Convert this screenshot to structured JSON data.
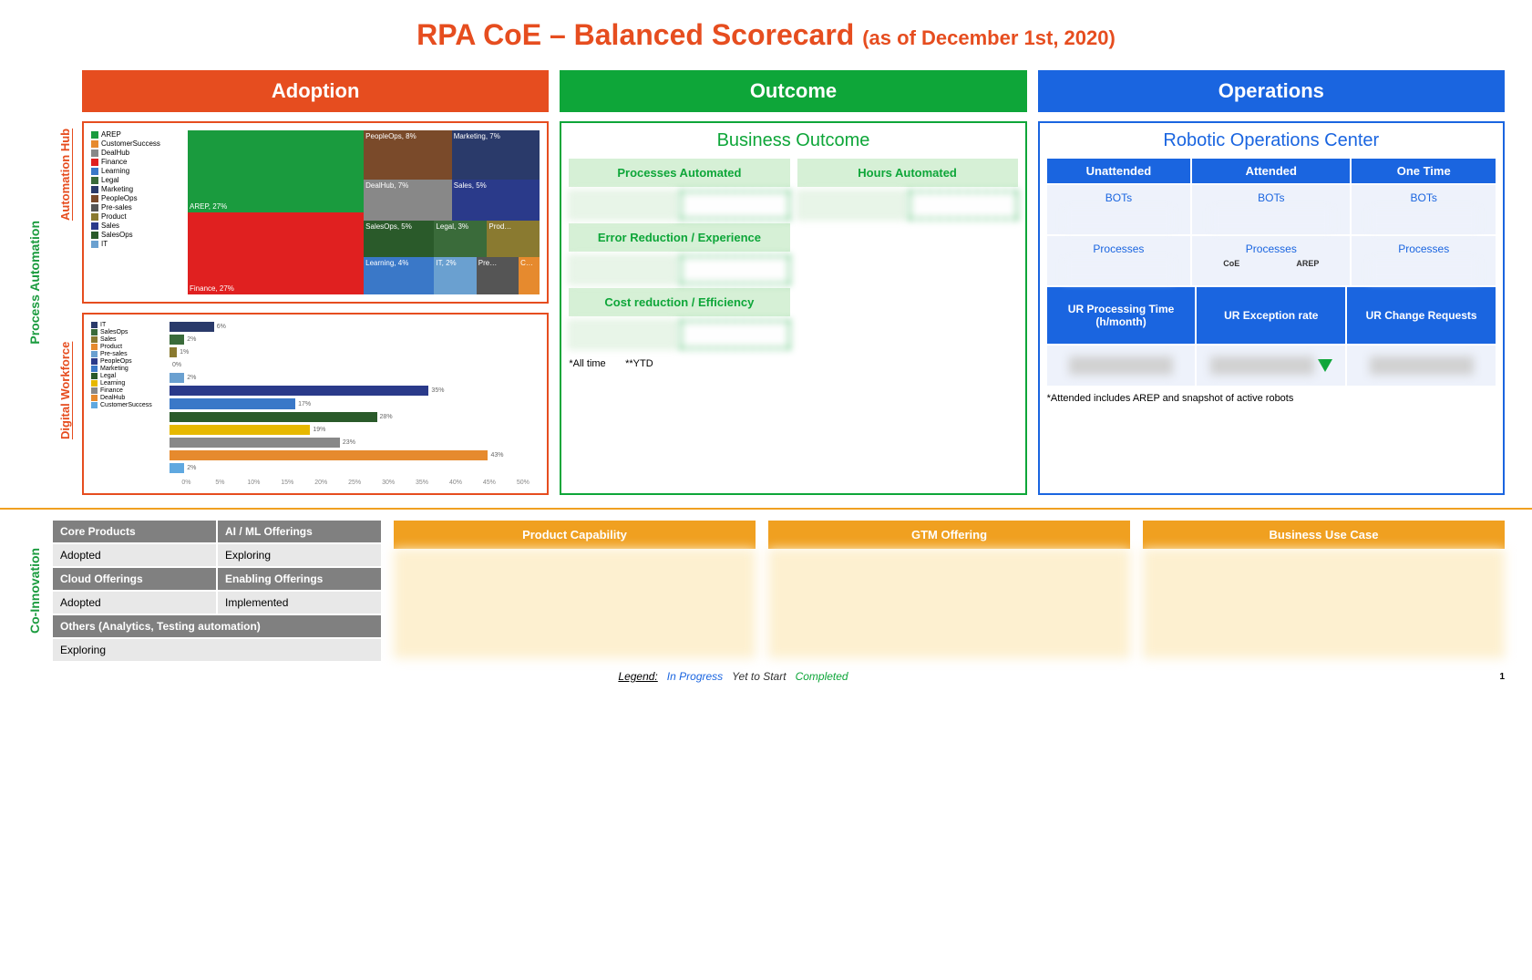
{
  "title": {
    "main": "RPA CoE – Balanced Scorecard ",
    "sub": "(as of December 1st, 2020)"
  },
  "section_label": "Process Automation",
  "panel_labels": {
    "hub": "Automation Hub",
    "dw": "Digital Workforce"
  },
  "columns": {
    "adoption": "Adoption",
    "outcome": "Outcome",
    "operations": "Operations"
  },
  "treemap_legend": [
    {
      "name": "AREP",
      "color": "#1a9b3e"
    },
    {
      "name": "CustomerSuccess",
      "color": "#e68a2e"
    },
    {
      "name": "DealHub",
      "color": "#888888"
    },
    {
      "name": "Finance",
      "color": "#e02020"
    },
    {
      "name": "Learning",
      "color": "#3a78c8"
    },
    {
      "name": "Legal",
      "color": "#3a6b3a"
    },
    {
      "name": "Marketing",
      "color": "#2a3a6a"
    },
    {
      "name": "PeopleOps",
      "color": "#7a4a2a"
    },
    {
      "name": "Pre-sales",
      "color": "#555555"
    },
    {
      "name": "Product",
      "color": "#8a7a30"
    },
    {
      "name": "Sales",
      "color": "#2a3a8a"
    },
    {
      "name": "SalesOps",
      "color": "#2a5a2a"
    },
    {
      "name": "IT",
      "color": "#6aa0d0"
    }
  ],
  "chart_data": [
    {
      "type": "treemap",
      "title": "Automation Hub",
      "unit": "percent",
      "data": [
        {
          "name": "AREP",
          "value": 27,
          "color": "#1a9b3e"
        },
        {
          "name": "Finance",
          "value": 27,
          "color": "#e02020"
        },
        {
          "name": "PeopleOps",
          "value": 8,
          "color": "#7a4a2a"
        },
        {
          "name": "Marketing",
          "value": 7,
          "color": "#2a3a6a"
        },
        {
          "name": "DealHub",
          "value": 7,
          "color": "#888888"
        },
        {
          "name": "Sales",
          "value": 5,
          "color": "#2a3a8a"
        },
        {
          "name": "SalesOps",
          "value": 5,
          "color": "#2a5a2a"
        },
        {
          "name": "Learning",
          "value": 4,
          "color": "#3a78c8"
        },
        {
          "name": "Legal",
          "value": 3,
          "color": "#3a6b3a"
        },
        {
          "name": "IT",
          "value": 2,
          "color": "#6aa0d0"
        },
        {
          "name": "Product",
          "value": 2,
          "color": "#8a7a30"
        },
        {
          "name": "Pre-sales",
          "value": 2,
          "color": "#555555"
        },
        {
          "name": "CustomerSuccess",
          "value": 1,
          "color": "#e68a2e"
        }
      ]
    },
    {
      "type": "bar",
      "title": "Digital Workforce",
      "xlabel": "percent",
      "xlim": [
        0,
        50
      ],
      "ticks": [
        "0%",
        "5%",
        "10%",
        "15%",
        "20%",
        "25%",
        "30%",
        "35%",
        "40%",
        "45%",
        "50%"
      ],
      "categories": [
        "IT",
        "SalesOps",
        "Sales",
        "Product",
        "Pre-sales",
        "PeopleOps",
        "Marketing",
        "Legal",
        "Learning",
        "Finance",
        "DealHub",
        "CustomerSuccess"
      ],
      "values": [
        6,
        2,
        1,
        0,
        2,
        35,
        17,
        28,
        19,
        23,
        43,
        2
      ],
      "colors": [
        "#2a3a6a",
        "#3a6b3a",
        "#8a7a30",
        "#e68a2e",
        "#6aa0d0",
        "#2a3a8a",
        "#3a78c8",
        "#2a5a2a",
        "#e6b800",
        "#888888",
        "#e68a2e",
        "#5fa8e0"
      ]
    }
  ],
  "outcome": {
    "title": "Business Outcome",
    "heads": {
      "pa": "Processes Automated",
      "ha": "Hours Automated",
      "err": "Error Reduction / Experience",
      "cost": "Cost reduction / Efficiency"
    },
    "notes": {
      "all": "*All time",
      "ytd": "**YTD"
    }
  },
  "ops": {
    "title": "Robotic Operations Center",
    "cols": [
      "Unattended",
      "Attended",
      "One Time"
    ],
    "rows": {
      "bots": "BOTs",
      "proc": "Processes"
    },
    "proc_split": {
      "coe": "CoE",
      "arep": "AREP"
    },
    "metrics": [
      "UR Processing Time (h/month)",
      "UR Exception rate",
      "UR Change Requests"
    ],
    "note": "*Attended includes AREP and snapshot of active robots"
  },
  "coinnovation_label": "Co-Innovation",
  "status": {
    "h1": "Core Products",
    "v1": "Adopted",
    "h2": "AI / ML Offerings",
    "v2": "Exploring",
    "h3": "Cloud Offerings",
    "v3": "Adopted",
    "h4": "Enabling Offerings",
    "v4": "Implemented",
    "h5": "Others (Analytics, Testing automation)",
    "v5": "Exploring"
  },
  "yellow_cards": [
    "Product Capability",
    "GTM Offering",
    "Business Use Case"
  ],
  "legend": {
    "label": "Legend:",
    "in_progress": "In Progress",
    "yet_to_start": "Yet to Start",
    "completed": "Completed"
  },
  "page_number": "1"
}
